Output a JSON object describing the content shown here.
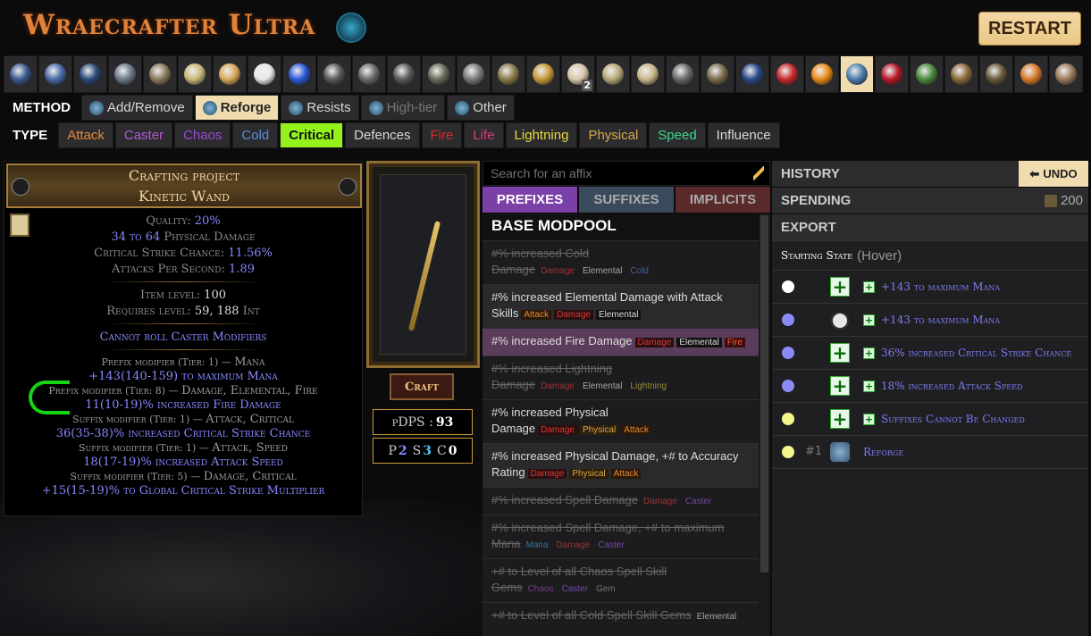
{
  "app": {
    "title": "Wraecrafter Ultra",
    "restart_label": "RESTART"
  },
  "currency": {
    "items": [
      {
        "name": "transmute",
        "color": "#3a5a8a"
      },
      {
        "name": "alteration",
        "color": "#4a6aa8"
      },
      {
        "name": "augmentation",
        "color": "#2a4a7a"
      },
      {
        "name": "regal",
        "color": "#6a7a8a"
      },
      {
        "name": "alchemy",
        "color": "#8a7a5a"
      },
      {
        "name": "chaos",
        "color": "#c8b878"
      },
      {
        "name": "exalted",
        "color": "#d8a85a"
      },
      {
        "name": "divine",
        "color": "#e8e8e8"
      },
      {
        "name": "annulment",
        "color": "#2a5ad8"
      },
      {
        "name": "scour",
        "color": "#5a5a5a"
      },
      {
        "name": "essence",
        "color": "#6a6a6a"
      },
      {
        "name": "fossil-1",
        "color": "#5a5a5a"
      },
      {
        "name": "fossil-2",
        "color": "#6a6a5a"
      },
      {
        "name": "fossil-3",
        "color": "#7a7a7a"
      },
      {
        "name": "fossil-4",
        "color": "#8a7a4a"
      },
      {
        "name": "orb-16",
        "color": "#c89a3a"
      },
      {
        "name": "orb-17",
        "color": "#d8c8a8",
        "count": "2"
      },
      {
        "name": "orb-18",
        "color": "#b8a878"
      },
      {
        "name": "orb-19",
        "color": "#c8b888"
      },
      {
        "name": "orb-20",
        "color": "#6a6a6a"
      },
      {
        "name": "orb-21",
        "color": "#7a6a4a"
      },
      {
        "name": "orb-22",
        "color": "#2a4a8a"
      },
      {
        "name": "orb-23",
        "color": "#c82a2a"
      },
      {
        "name": "orb-24",
        "color": "#e88a1a"
      },
      {
        "name": "reforge-bench",
        "color": "#4a7aa8",
        "active": true
      },
      {
        "name": "orb-26",
        "color": "#b81a2a"
      },
      {
        "name": "orb-27",
        "color": "#4a8a3a"
      },
      {
        "name": "orb-28",
        "color": "#8a6a3a"
      },
      {
        "name": "orb-29",
        "color": "#6a5a3a"
      },
      {
        "name": "orb-30",
        "color": "#d87a2a"
      },
      {
        "name": "orb-31",
        "color": "#9a7a5a"
      }
    ]
  },
  "method": {
    "label": "METHOD",
    "options": [
      "Add/Remove",
      "Reforge",
      "Resists",
      "High-tier",
      "Other"
    ]
  },
  "type": {
    "label": "TYPE",
    "options": [
      {
        "label": "Attack",
        "color": "#e68a3a"
      },
      {
        "label": "Caster",
        "color": "#b25ad8"
      },
      {
        "label": "Chaos",
        "color": "#9a4ad8"
      },
      {
        "label": "Cold",
        "color": "#5a8ad8"
      },
      {
        "label": "Critical",
        "color": "#111111",
        "active": true
      },
      {
        "label": "Defences",
        "color": "#d8d8d8"
      },
      {
        "label": "Fire",
        "color": "#d82a2a"
      },
      {
        "label": "Life",
        "color": "#d83a7a"
      },
      {
        "label": "Lightning",
        "color": "#e8d83a"
      },
      {
        "label": "Physical",
        "color": "#d8a84a"
      },
      {
        "label": "Speed",
        "color": "#3ad88a"
      },
      {
        "label": "Influence",
        "color": "#d8d8d8"
      }
    ]
  },
  "item": {
    "header_line1": "Crafting project",
    "header_line2": "Kinetic Wand",
    "quality_label": "Quality:",
    "quality": "20%",
    "phys_pre": "34",
    "phys_to": "to",
    "phys_post": "64",
    "phys_label": "Physical Damage",
    "crit_label": "Critical Strike Chance:",
    "crit": "11.56%",
    "aps_label": "Attacks Per Second:",
    "aps": "1.89",
    "ilvl_label": "Item level:",
    "ilvl": "100",
    "req_label": "Requires level:",
    "req_level": "59,",
    "req_int": "188",
    "req_int_label": "Int",
    "cannot_roll": "Cannot roll Caster Modifiers",
    "mods": [
      {
        "label": "Prefix modifier (Tier: 1) — ",
        "tags": "Mana",
        "text": "+143(140-159) to maximum Mana"
      },
      {
        "label": "Prefix modifier (Tier: 8) — ",
        "tags": "Damage, Elemental, Fire",
        "text": "11(10-19)% increased Fire Damage"
      },
      {
        "label": "Suffix modifier (Tier: 1) — ",
        "tags": "Attack, Critical",
        "text": "36(35-38)% increased Critical Strike Chance"
      },
      {
        "label": "Suffix modifier (Tier: 1) — ",
        "tags": "Attack, Speed",
        "text": "18(17-19)% increased Attack Speed"
      },
      {
        "label": "Suffix modifier (Tier: 5) — ",
        "tags": "Damage, Critical",
        "text": "+15(15-19)% to Global Critical Strike Multiplier"
      }
    ]
  },
  "craft": {
    "label": "Craft"
  },
  "stats": {
    "pdps_label": "pDPS :",
    "pdps": "93",
    "p_label": "P",
    "p": "2",
    "s_label": "S",
    "s": "3",
    "c_label": "C",
    "c": "0"
  },
  "search": {
    "placeholder": "Search for an affix"
  },
  "tabs": {
    "prefixes": "PREFIXES",
    "suffixes": "SUFFIXES",
    "implicits": "IMPLICITS"
  },
  "modpool": {
    "title": "BASE MODPOOL",
    "rows": [
      {
        "text": "#% increased Cold Damage",
        "tags": [
          [
            "Damage",
            "dmg"
          ],
          [
            "Elemental",
            "ele"
          ],
          [
            "Cold",
            "cold"
          ]
        ],
        "disabled": true
      },
      {
        "text": "#% increased Elemental Damage with Attack Skills",
        "tags": [
          [
            "Attack",
            "atk"
          ],
          [
            "Damage",
            "dmg"
          ],
          [
            "Elemental",
            "ele"
          ]
        ],
        "alt": true
      },
      {
        "text": "#% increased Fire Damage",
        "tags": [
          [
            "Damage",
            "dmg"
          ],
          [
            "Elemental",
            "ele"
          ],
          [
            "Fire",
            "fire"
          ]
        ],
        "highlight": true
      },
      {
        "text": "#% increased Lightning Damage",
        "tags": [
          [
            "Damage",
            "dmg"
          ],
          [
            "Elemental",
            "ele"
          ],
          [
            "Lightning",
            "light"
          ]
        ],
        "disabled": true
      },
      {
        "text": "#% increased Physical Damage",
        "tags": [
          [
            "Damage",
            "dmg"
          ],
          [
            "Physical",
            "phys"
          ],
          [
            "Attack",
            "atk"
          ]
        ]
      },
      {
        "text": "#% increased Physical Damage, +# to Accuracy Rating",
        "tags": [
          [
            "Damage",
            "dmg"
          ],
          [
            "Physical",
            "phys"
          ],
          [
            "Attack",
            "atk"
          ]
        ],
        "alt": true
      },
      {
        "text": "#% increased Spell Damage",
        "tags": [
          [
            "Damage",
            "dmg"
          ],
          [
            "Caster",
            "cast"
          ]
        ],
        "disabled": true
      },
      {
        "text": "#% increased Spell Damage, +# to maximum Mana",
        "tags": [
          [
            "Mana",
            "mana"
          ],
          [
            "Damage",
            "dmg"
          ],
          [
            "Caster",
            "cast"
          ]
        ],
        "disabled": true
      },
      {
        "text": "+# to Level of all Chaos Spell Skill Gems",
        "tags": [
          [
            "Chaos",
            "chaos"
          ],
          [
            "Caster",
            "cast"
          ],
          [
            "Gem",
            "gem"
          ]
        ],
        "disabled": true
      },
      {
        "text": "+# to Level of all Cold Spell Skill Gems",
        "tags": [
          [
            "Elemental",
            "ele"
          ]
        ],
        "disabled": true
      }
    ]
  },
  "history": {
    "title": "HISTORY",
    "undo_label": "UNDO",
    "spending_label": "SPENDING",
    "spending_value": "200",
    "export_label": "EXPORT",
    "starting_state": "Starting State",
    "hover": "(Hover)",
    "rows": [
      {
        "dot": "#ffffff",
        "action": "plus",
        "text": "+143 to maximum Mana"
      },
      {
        "dot": "#8a8af5",
        "action": "orb",
        "text": "+143 to maximum Mana"
      },
      {
        "dot": "#8a8af5",
        "action": "plus",
        "text": "36% increased Critical Strike Chance"
      },
      {
        "dot": "#8a8af5",
        "action": "plus",
        "text": "18% increased Attack Speed"
      },
      {
        "dot": "#f5f58a",
        "action": "plus",
        "text": "Suffixes Cannot Be Changed"
      },
      {
        "dot": "#f5f58a",
        "action": "reforge",
        "num": "#1",
        "text": "Reforge"
      }
    ]
  }
}
